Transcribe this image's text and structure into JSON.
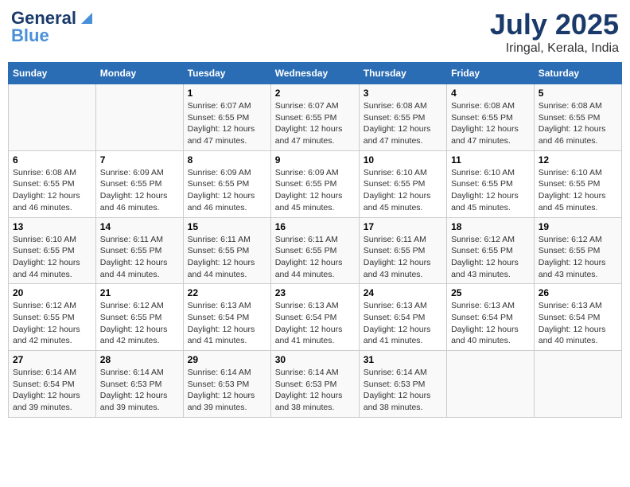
{
  "header": {
    "logo_line1": "General",
    "logo_line2": "Blue",
    "title": "July 2025",
    "subtitle": "Iringal, Kerala, India"
  },
  "days_of_week": [
    "Sunday",
    "Monday",
    "Tuesday",
    "Wednesday",
    "Thursday",
    "Friday",
    "Saturday"
  ],
  "weeks": [
    [
      {
        "day": "",
        "sunrise": "",
        "sunset": "",
        "daylight": ""
      },
      {
        "day": "",
        "sunrise": "",
        "sunset": "",
        "daylight": ""
      },
      {
        "day": "1",
        "sunrise": "Sunrise: 6:07 AM",
        "sunset": "Sunset: 6:55 PM",
        "daylight": "Daylight: 12 hours and 47 minutes."
      },
      {
        "day": "2",
        "sunrise": "Sunrise: 6:07 AM",
        "sunset": "Sunset: 6:55 PM",
        "daylight": "Daylight: 12 hours and 47 minutes."
      },
      {
        "day": "3",
        "sunrise": "Sunrise: 6:08 AM",
        "sunset": "Sunset: 6:55 PM",
        "daylight": "Daylight: 12 hours and 47 minutes."
      },
      {
        "day": "4",
        "sunrise": "Sunrise: 6:08 AM",
        "sunset": "Sunset: 6:55 PM",
        "daylight": "Daylight: 12 hours and 47 minutes."
      },
      {
        "day": "5",
        "sunrise": "Sunrise: 6:08 AM",
        "sunset": "Sunset: 6:55 PM",
        "daylight": "Daylight: 12 hours and 46 minutes."
      }
    ],
    [
      {
        "day": "6",
        "sunrise": "Sunrise: 6:08 AM",
        "sunset": "Sunset: 6:55 PM",
        "daylight": "Daylight: 12 hours and 46 minutes."
      },
      {
        "day": "7",
        "sunrise": "Sunrise: 6:09 AM",
        "sunset": "Sunset: 6:55 PM",
        "daylight": "Daylight: 12 hours and 46 minutes."
      },
      {
        "day": "8",
        "sunrise": "Sunrise: 6:09 AM",
        "sunset": "Sunset: 6:55 PM",
        "daylight": "Daylight: 12 hours and 46 minutes."
      },
      {
        "day": "9",
        "sunrise": "Sunrise: 6:09 AM",
        "sunset": "Sunset: 6:55 PM",
        "daylight": "Daylight: 12 hours and 45 minutes."
      },
      {
        "day": "10",
        "sunrise": "Sunrise: 6:10 AM",
        "sunset": "Sunset: 6:55 PM",
        "daylight": "Daylight: 12 hours and 45 minutes."
      },
      {
        "day": "11",
        "sunrise": "Sunrise: 6:10 AM",
        "sunset": "Sunset: 6:55 PM",
        "daylight": "Daylight: 12 hours and 45 minutes."
      },
      {
        "day": "12",
        "sunrise": "Sunrise: 6:10 AM",
        "sunset": "Sunset: 6:55 PM",
        "daylight": "Daylight: 12 hours and 45 minutes."
      }
    ],
    [
      {
        "day": "13",
        "sunrise": "Sunrise: 6:10 AM",
        "sunset": "Sunset: 6:55 PM",
        "daylight": "Daylight: 12 hours and 44 minutes."
      },
      {
        "day": "14",
        "sunrise": "Sunrise: 6:11 AM",
        "sunset": "Sunset: 6:55 PM",
        "daylight": "Daylight: 12 hours and 44 minutes."
      },
      {
        "day": "15",
        "sunrise": "Sunrise: 6:11 AM",
        "sunset": "Sunset: 6:55 PM",
        "daylight": "Daylight: 12 hours and 44 minutes."
      },
      {
        "day": "16",
        "sunrise": "Sunrise: 6:11 AM",
        "sunset": "Sunset: 6:55 PM",
        "daylight": "Daylight: 12 hours and 44 minutes."
      },
      {
        "day": "17",
        "sunrise": "Sunrise: 6:11 AM",
        "sunset": "Sunset: 6:55 PM",
        "daylight": "Daylight: 12 hours and 43 minutes."
      },
      {
        "day": "18",
        "sunrise": "Sunrise: 6:12 AM",
        "sunset": "Sunset: 6:55 PM",
        "daylight": "Daylight: 12 hours and 43 minutes."
      },
      {
        "day": "19",
        "sunrise": "Sunrise: 6:12 AM",
        "sunset": "Sunset: 6:55 PM",
        "daylight": "Daylight: 12 hours and 43 minutes."
      }
    ],
    [
      {
        "day": "20",
        "sunrise": "Sunrise: 6:12 AM",
        "sunset": "Sunset: 6:55 PM",
        "daylight": "Daylight: 12 hours and 42 minutes."
      },
      {
        "day": "21",
        "sunrise": "Sunrise: 6:12 AM",
        "sunset": "Sunset: 6:55 PM",
        "daylight": "Daylight: 12 hours and 42 minutes."
      },
      {
        "day": "22",
        "sunrise": "Sunrise: 6:13 AM",
        "sunset": "Sunset: 6:54 PM",
        "daylight": "Daylight: 12 hours and 41 minutes."
      },
      {
        "day": "23",
        "sunrise": "Sunrise: 6:13 AM",
        "sunset": "Sunset: 6:54 PM",
        "daylight": "Daylight: 12 hours and 41 minutes."
      },
      {
        "day": "24",
        "sunrise": "Sunrise: 6:13 AM",
        "sunset": "Sunset: 6:54 PM",
        "daylight": "Daylight: 12 hours and 41 minutes."
      },
      {
        "day": "25",
        "sunrise": "Sunrise: 6:13 AM",
        "sunset": "Sunset: 6:54 PM",
        "daylight": "Daylight: 12 hours and 40 minutes."
      },
      {
        "day": "26",
        "sunrise": "Sunrise: 6:13 AM",
        "sunset": "Sunset: 6:54 PM",
        "daylight": "Daylight: 12 hours and 40 minutes."
      }
    ],
    [
      {
        "day": "27",
        "sunrise": "Sunrise: 6:14 AM",
        "sunset": "Sunset: 6:54 PM",
        "daylight": "Daylight: 12 hours and 39 minutes."
      },
      {
        "day": "28",
        "sunrise": "Sunrise: 6:14 AM",
        "sunset": "Sunset: 6:53 PM",
        "daylight": "Daylight: 12 hours and 39 minutes."
      },
      {
        "day": "29",
        "sunrise": "Sunrise: 6:14 AM",
        "sunset": "Sunset: 6:53 PM",
        "daylight": "Daylight: 12 hours and 39 minutes."
      },
      {
        "day": "30",
        "sunrise": "Sunrise: 6:14 AM",
        "sunset": "Sunset: 6:53 PM",
        "daylight": "Daylight: 12 hours and 38 minutes."
      },
      {
        "day": "31",
        "sunrise": "Sunrise: 6:14 AM",
        "sunset": "Sunset: 6:53 PM",
        "daylight": "Daylight: 12 hours and 38 minutes."
      },
      {
        "day": "",
        "sunrise": "",
        "sunset": "",
        "daylight": ""
      },
      {
        "day": "",
        "sunrise": "",
        "sunset": "",
        "daylight": ""
      }
    ]
  ]
}
